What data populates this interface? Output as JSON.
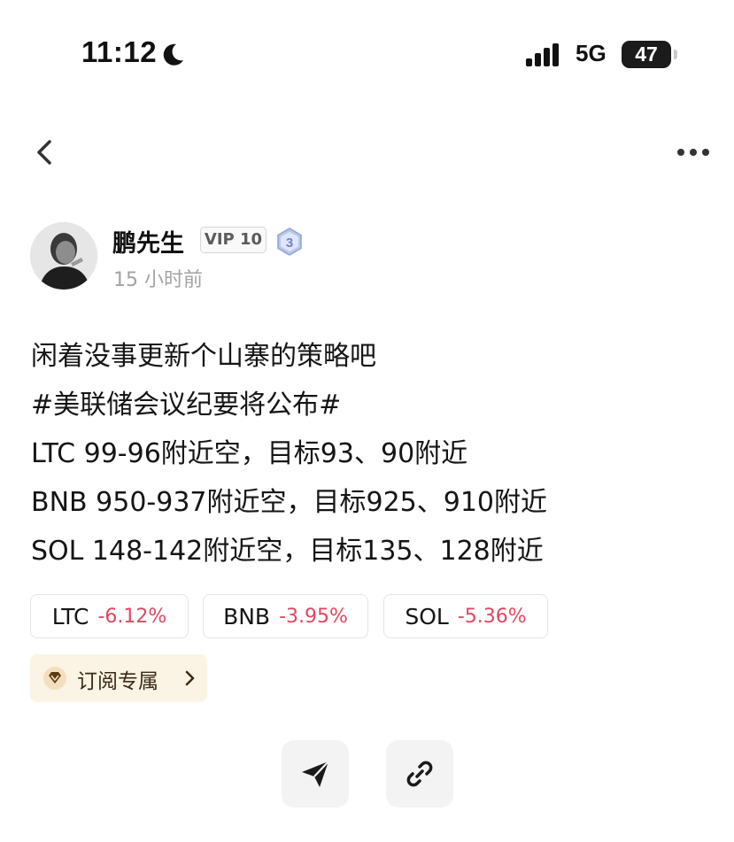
{
  "status_bar": {
    "time": "11:12",
    "network": "5G",
    "battery": "47"
  },
  "nav": {
    "back_icon": "chevron-left-icon",
    "more_icon": "more-horizontal-icon"
  },
  "author": {
    "name": "鹏先生",
    "vip_badge": "VIP 10",
    "level_badge": "3",
    "post_time": "15 小时前"
  },
  "post": {
    "lines": [
      "闲着没事更新个山寨的策略吧",
      "#美联储会议纪要将公布#",
      "LTC 99-96附近空，目标93、90附近",
      "BNB 950-937附近空，目标925、910附近",
      "SOL 148-142附近空，目标135、128附近"
    ]
  },
  "tickers": [
    {
      "symbol": "LTC",
      "change": "-6.12%"
    },
    {
      "symbol": "BNB",
      "change": "-3.95%"
    },
    {
      "symbol": "SOL",
      "change": "-5.36%"
    }
  ],
  "subscribe": {
    "label": "订阅专属",
    "icon": "diamond-icon"
  },
  "actions": {
    "share_icon": "send-icon",
    "link_icon": "link-icon"
  },
  "colors": {
    "negative": "#e0475f",
    "subscribe_bg": "#fbf3e4",
    "action_bg": "#f3f3f3"
  }
}
